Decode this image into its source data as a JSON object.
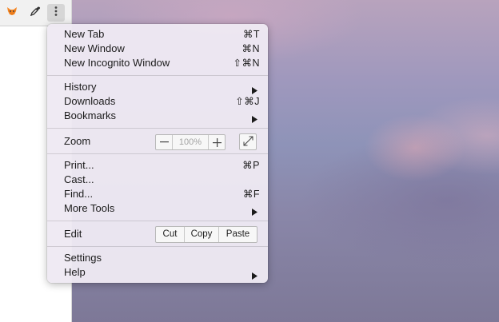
{
  "toolbar": {
    "icons": [
      "fox-extension-icon",
      "eyedropper-icon",
      "more-vert-icon"
    ]
  },
  "menu": {
    "new_tab": {
      "label": "New Tab",
      "shortcut": "⌘T"
    },
    "new_window": {
      "label": "New Window",
      "shortcut": "⌘N"
    },
    "new_incognito": {
      "label": "New Incognito Window",
      "shortcut": "⇧⌘N"
    },
    "history": {
      "label": "History"
    },
    "downloads": {
      "label": "Downloads",
      "shortcut": "⇧⌘J"
    },
    "bookmarks": {
      "label": "Bookmarks"
    },
    "zoom": {
      "label": "Zoom",
      "minus": "—",
      "value": "100%",
      "plus": "+"
    },
    "print": {
      "label": "Print...",
      "shortcut": "⌘P"
    },
    "cast": {
      "label": "Cast..."
    },
    "find": {
      "label": "Find...",
      "shortcut": "⌘F"
    },
    "more_tools": {
      "label": "More Tools"
    },
    "edit": {
      "label": "Edit",
      "cut": "Cut",
      "copy": "Copy",
      "paste": "Paste"
    },
    "settings": {
      "label": "Settings"
    },
    "help": {
      "label": "Help"
    }
  },
  "colors": {
    "menu_bg": "#eee9f2",
    "text": "#1b1b1b",
    "disabled_text": "#a3a3a3",
    "extension_orange": "#f5841f"
  }
}
